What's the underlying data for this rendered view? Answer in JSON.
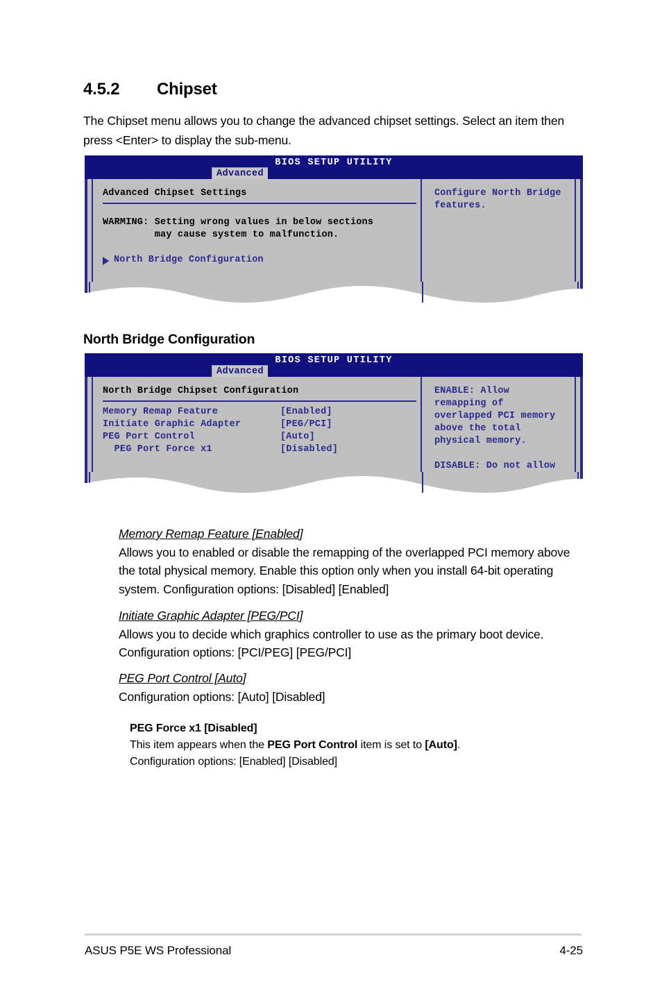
{
  "section": {
    "number": "4.5.2",
    "title": "Chipset",
    "intro": "The Chipset menu allows you to change the advanced chipset settings. Select an item then press <Enter> to display the sub-menu."
  },
  "bios_screen_1": {
    "title": "BIOS SETUP UTILITY",
    "tab": "Advanced",
    "pane_title": "Advanced Chipset Settings",
    "warning_line1": "WARMING: Setting wrong values in below sections",
    "warning_line2": "         may cause system to malfunction.",
    "submenu_item": "North Bridge Configuration",
    "help_text": "Configure North Bridge\nfeatures."
  },
  "subsection": {
    "title": "North Bridge Configuration"
  },
  "bios_screen_2": {
    "title": "BIOS SETUP UTILITY",
    "tab": "Advanced",
    "pane_title": "North Bridge Chipset Configuration",
    "settings": [
      {
        "label": "Memory Remap Feature",
        "value": "[Enabled]"
      },
      {
        "label": "Initiate Graphic Adapter",
        "value": "[PEG/PCI]"
      },
      {
        "label": "PEG Port Control",
        "value": "[Auto]"
      },
      {
        "label": "  PEG Port Force x1",
        "value": "[Disabled]"
      }
    ],
    "help_enable": "ENABLE: Allow\nremapping of\noverlapped PCI memory\nabove the total\nphysical memory.",
    "help_disable": "DISABLE: Do not allow\nremapping of memory."
  },
  "items": [
    {
      "heading": "Memory Remap Feature [Enabled]",
      "body": "Allows you to enabled or disable the remapping of the overlapped PCI memory above the total physical memory. Enable this option only when you install 64-bit operating system. Configuration options: [Disabled] [Enabled]"
    },
    {
      "heading": "Initiate Graphic Adapter [PEG/PCI]",
      "body": "Allows you to decide which graphics controller to use as the primary boot device. Configuration options: [PCI/PEG] [PEG/PCI]"
    },
    {
      "heading": "PEG Port Control [Auto]",
      "body": "Configuration options: [Auto] [Disabled]"
    }
  ],
  "subitem": {
    "heading": "PEG Force x1 [Disabled]",
    "line1_a": "This item appears when the ",
    "line1_b": "PEG Port Control",
    "line1_c": " item is set to ",
    "line1_d": "[Auto]",
    "line1_e": ".",
    "line2": "Configuration options: [Enabled] [Disabled]"
  },
  "footer": {
    "left": "ASUS P5E WS Professional",
    "right": "4-25"
  },
  "colors": {
    "bios_titlebar": "#10107e",
    "bios_border": "#2a2a8c",
    "bios_body": "#c0c0c0",
    "bios_text_blue": "#2a2a8c",
    "tab_bg": "#c8c8c8",
    "footer_rule": "#d4d4d4"
  }
}
